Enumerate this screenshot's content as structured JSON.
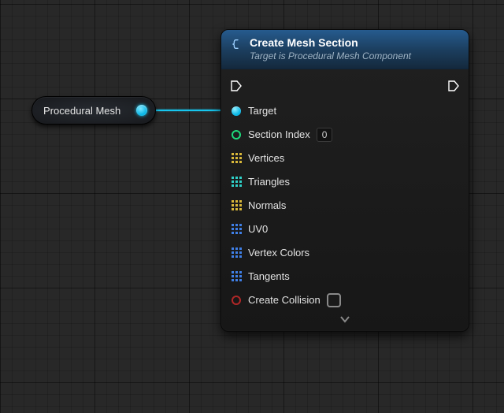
{
  "colors": {
    "exec": "#ffffff",
    "object": "#17c6ee",
    "int": "#1ed97a",
    "vec": "#d9b83a",
    "intArr": "#2fd0c8",
    "struct": "#3f7fe6",
    "bool": "#b02727"
  },
  "varNode": {
    "label": "Procedural Mesh"
  },
  "funcNode": {
    "title": "Create Mesh Section",
    "subtitle": "Target is Procedural Mesh Component",
    "pins": {
      "target": "Target",
      "sectionIndex": "Section Index",
      "sectionIndexValue": "0",
      "vertices": "Vertices",
      "triangles": "Triangles",
      "normals": "Normals",
      "uv0": "UV0",
      "vertexColors": "Vertex Colors",
      "tangents": "Tangents",
      "createCollision": "Create Collision"
    }
  }
}
